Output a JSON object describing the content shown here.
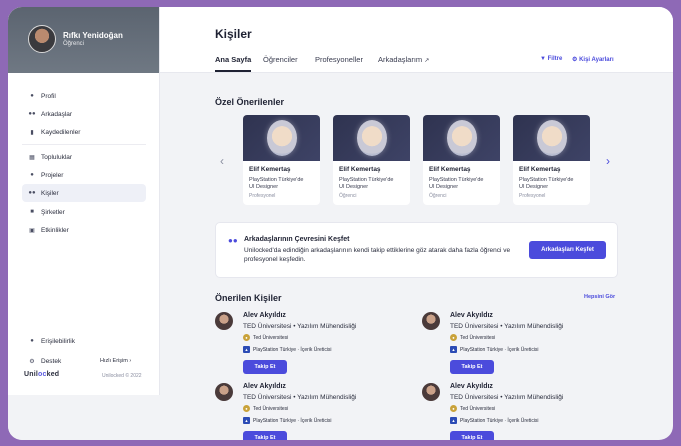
{
  "user": {
    "name": "Rıfkı Yenidoğan",
    "role": "Öğrenci"
  },
  "sidebar": {
    "items": [
      {
        "label": "Profil",
        "icon": "person-icon"
      },
      {
        "label": "Arkadaşlar",
        "icon": "people-icon"
      },
      {
        "label": "Kaydedilenler",
        "icon": "bookmark-icon"
      },
      {
        "label": "Topluluklar",
        "icon": "community-icon"
      },
      {
        "label": "Projeler",
        "icon": "lightbulb-icon"
      },
      {
        "label": "Kişiler",
        "icon": "contacts-icon"
      },
      {
        "label": "Şirketler",
        "icon": "briefcase-icon"
      },
      {
        "label": "Etkinlikler",
        "icon": "calendar-icon"
      }
    ],
    "accessibility": "Erişilebilirlik",
    "support": "Destek",
    "quick_access": "Hızlı Erişim",
    "brand_pre": "Unil",
    "brand_mid": "oc",
    "brand_post": "ked",
    "copyright": "Unilocked © 2022"
  },
  "header": {
    "title": "Kişiler",
    "tabs": [
      "Ana Sayfa",
      "Öğrenciler",
      "Profesyoneller",
      "Arkadaşlarım"
    ],
    "filter": "Filtre",
    "settings": "Kişi Ayarları"
  },
  "suggestions": {
    "title": "Özel Önerilenler",
    "cards": [
      {
        "name": "Elif Kemertaş",
        "title": "PlayStation Türkiye'de UI Designer",
        "role": "Profesyonel"
      },
      {
        "name": "Elif Kemertaş",
        "title": "PlayStation Türkiye'de UI Designer",
        "role": "Öğrenci"
      },
      {
        "name": "Elif Kemertaş",
        "title": "PlayStation Türkiye'de UI Designer",
        "role": "Öğrenci"
      },
      {
        "name": "Elif Kemertaş",
        "title": "PlayStation Türkiye'de UI Designer",
        "role": "Profesyonel"
      }
    ]
  },
  "explore": {
    "title": "Arkadaşlarının Çevresini Keşfet",
    "text": "Unilocked'da edindiğin arkadaşlarının kendi takip ettiklerine göz atarak daha fazla öğrenci ve profesyonel keşfedin.",
    "button": "Arkadaşları Keşfet"
  },
  "recommended": {
    "title": "Önerilen Kişiler",
    "see_all": "Hepsini Gör",
    "people": [
      {
        "name": "Alev Akyıldız",
        "subtitle": "TED Üniversitesi • Yazılım Mühendisliği",
        "org1": "Ted Üniversitesi",
        "org2": "PlayStation Türkiye · İçerik Üreticisi",
        "button": "Takip Et"
      },
      {
        "name": "Alev Akyıldız",
        "subtitle": "TED Üniversitesi • Yazılım Mühendisliği",
        "org1": "Ted Üniversitesi",
        "org2": "PlayStation Türkiye · İçerik Üreticisi",
        "button": "Takip Et"
      },
      {
        "name": "Alev Akyıldız",
        "subtitle": "TED Üniversitesi • Yazılım Mühendisliği",
        "org1": "Ted Üniversitesi",
        "org2": "PlayStation Türkiye · İçerik Üreticisi",
        "button": "Takip Et"
      },
      {
        "name": "Alev Akyıldız",
        "subtitle": "TED Üniversitesi • Yazılım Mühendisliği",
        "org1": "Ted Üniversitesi",
        "org2": "PlayStation Türkiye · İçerik Üreticisi",
        "button": "Takip Et"
      }
    ]
  },
  "colors": {
    "accent": "#4b4bdc",
    "frame": "#8e69b6"
  }
}
